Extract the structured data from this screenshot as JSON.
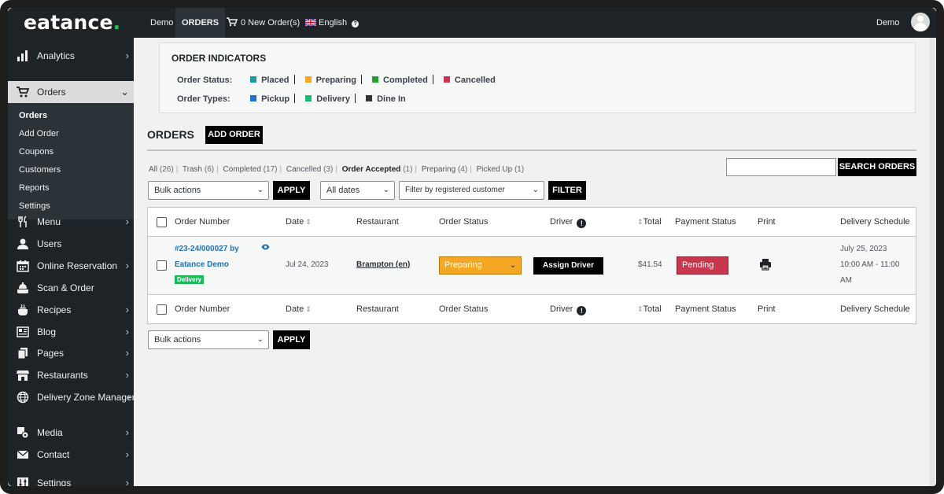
{
  "topbar": {
    "logo_text": "eatance",
    "logo_dot": ".",
    "site_name": "Demo",
    "orders_label": "ORDERS",
    "new_orders": "0 New Order(s)",
    "language": "English",
    "user_name": "Demo"
  },
  "sidebar": {
    "items": [
      {
        "label": "Analytics",
        "icon": "bar-chart-icon"
      },
      {
        "label": "Orders",
        "icon": "cart-icon"
      },
      {
        "label": "Menu",
        "icon": "fork-knife-icon"
      },
      {
        "label": "Users",
        "icon": "user-icon"
      },
      {
        "label": "Online Reservation",
        "icon": "calendar-icon"
      },
      {
        "label": "Scan & Order",
        "icon": "scan-icon"
      },
      {
        "label": "Recipes",
        "icon": "pot-icon"
      },
      {
        "label": "Blog",
        "icon": "blog-icon"
      },
      {
        "label": "Pages",
        "icon": "pages-icon"
      },
      {
        "label": "Restaurants",
        "icon": "store-icon"
      },
      {
        "label": "Delivery Zone Manager",
        "icon": "globe-icon"
      },
      {
        "label": "Media",
        "icon": "media-icon"
      },
      {
        "label": "Contact",
        "icon": "mail-icon"
      },
      {
        "label": "Settings",
        "icon": "settings-icon"
      }
    ],
    "submenu": [
      "Orders",
      "Add Order",
      "Coupons",
      "Customers",
      "Reports",
      "Settings"
    ]
  },
  "indicators": {
    "title": "ORDER INDICATORS",
    "status_label": "Order Status:",
    "statuses": [
      {
        "label": "Placed",
        "color": "#1a9aa0"
      },
      {
        "label": "Preparing",
        "color": "#f5a623"
      },
      {
        "label": "Completed",
        "color": "#22a12a"
      },
      {
        "label": "Cancelled",
        "color": "#c8374e"
      }
    ],
    "types_label": "Order Types:",
    "types": [
      {
        "label": "Pickup",
        "color": "#2271d1"
      },
      {
        "label": "Delivery",
        "color": "#1cb87a"
      },
      {
        "label": "Dine In",
        "color": "#333333"
      }
    ]
  },
  "page": {
    "title": "ORDERS",
    "add_order": "ADD ORDER",
    "search_button": "SEARCH ORDERS",
    "filter_links": [
      {
        "label": "All",
        "count": "(26)"
      },
      {
        "label": "Trash",
        "count": "(6)"
      },
      {
        "label": "Completed",
        "count": "(17)"
      },
      {
        "label": "Cancelled",
        "count": "(3)"
      },
      {
        "label": "Order Accepted",
        "count": "(1)"
      },
      {
        "label": "Preparing",
        "count": "(4)"
      },
      {
        "label": "Picked Up",
        "count": "(1)"
      }
    ],
    "bulk_actions": "Bulk actions",
    "apply": "APPLY",
    "all_dates": "All dates",
    "customer_filter": "Filter by registered customer",
    "filter": "FILTER"
  },
  "table": {
    "columns": [
      "Order Number",
      "Date",
      "Restaurant",
      "Order Status",
      "Driver",
      "Total",
      "Payment Status",
      "Print",
      "Delivery Schedule"
    ],
    "rows": [
      {
        "order_number": "#23-24/000027 by",
        "customer": "Eatance Demo",
        "type_badge": "Delivery",
        "date": "Jul 24, 2023",
        "restaurant": "Brampton (en)",
        "status": "Preparing",
        "driver_button": "Assign Driver",
        "total": "$41.54",
        "payment": "Pending",
        "schedule_date": "July 25, 2023",
        "schedule_time1": "10:00 AM - 11:00",
        "schedule_time2": "AM"
      }
    ]
  }
}
